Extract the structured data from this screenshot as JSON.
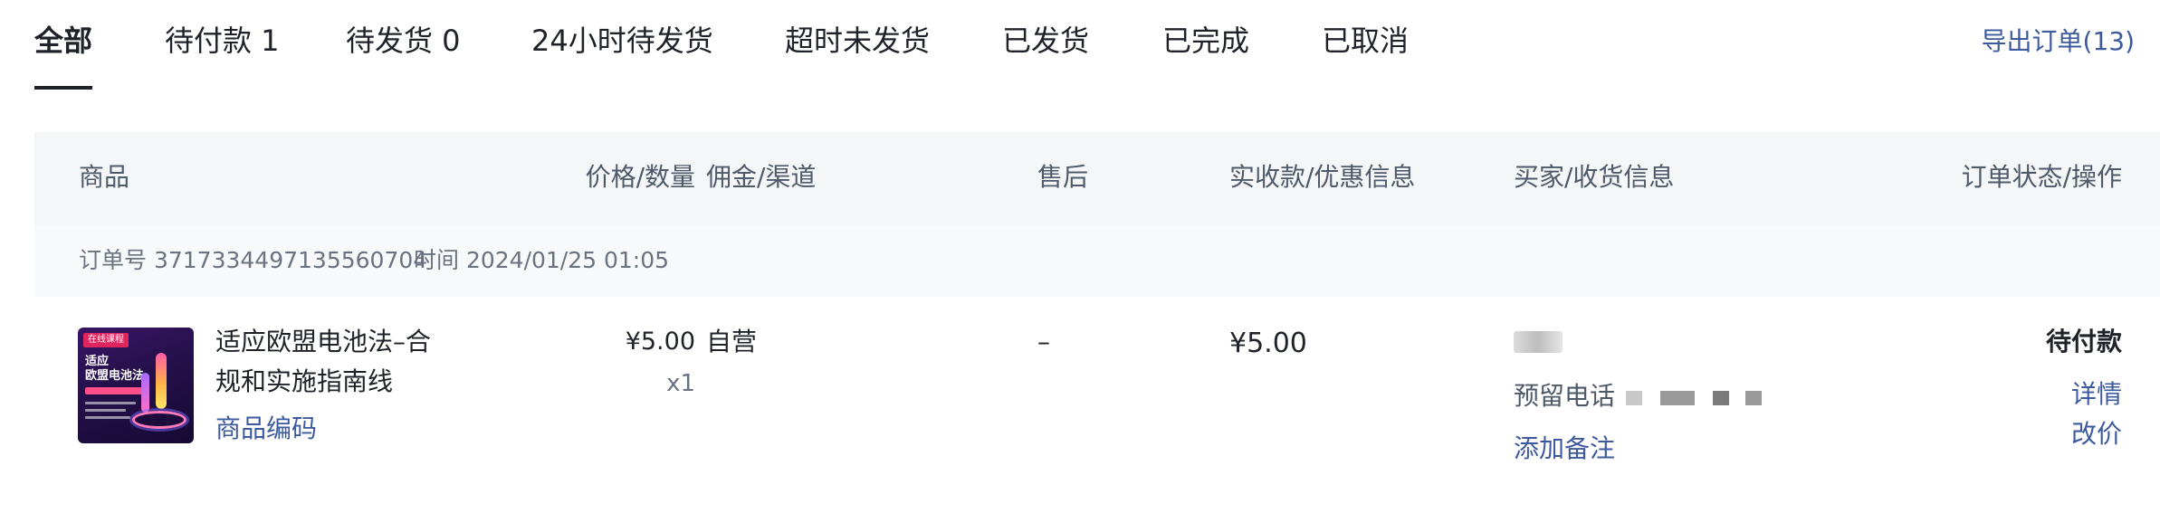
{
  "tabs": [
    {
      "label": "全部",
      "active": true
    },
    {
      "label": "待付款 1"
    },
    {
      "label": "待发货 0"
    },
    {
      "label": "24小时待发货"
    },
    {
      "label": "超时未发货"
    },
    {
      "label": "已发货"
    },
    {
      "label": "已完成"
    },
    {
      "label": "已取消"
    }
  ],
  "export_label": "导出订单(13)",
  "table": {
    "headers": {
      "product": "商品",
      "price_qty": "价格/数量",
      "commission": "佣金/渠道",
      "aftersale": "售后",
      "paid": "实收款/优惠信息",
      "buyer": "买家/收货信息",
      "status": "订单状态/操作"
    }
  },
  "order": {
    "number_text": "订单号 3717334497135560704",
    "time_text": "时间 2024/01/25 01:05",
    "product_title": "适应欧盟电池法–合规和实施指南线",
    "product_code_label": "商品编码",
    "thumb": {
      "badge": "在线课程",
      "title": "适应\n欧盟电池法"
    },
    "price": "¥5.00",
    "qty": "x1",
    "channel": "自营",
    "aftersale": "–",
    "paid": "¥5.00",
    "phone_label": "预留电话",
    "add_note_label": "添加备注",
    "status": "待付款",
    "detail_label": "详情",
    "edit_price_label": "改价"
  },
  "colors": {
    "link": "#3d5a9e",
    "text": "#1f2329",
    "muted": "#6b7280",
    "header_bg": "#f5f6f7"
  }
}
